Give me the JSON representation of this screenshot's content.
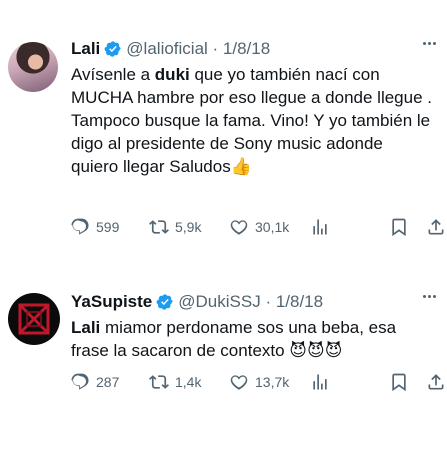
{
  "tweets": [
    {
      "name": "Lali",
      "handle": "@lalioficial",
      "date": "1/8/18",
      "text_lines": [
        [
          "Avísenle a ",
          "duki",
          " que yo también nací con"
        ],
        [
          "MUCHA hambre por eso llegue a donde llegue ."
        ],
        [
          "Tampoco busque la fama. Vino! Y yo también le"
        ],
        [
          "digo al presidente de Sony music adonde"
        ],
        [
          "quiero llegar Saludos",
          "👍"
        ]
      ],
      "stats": {
        "replies": "599",
        "reposts": "5,9k",
        "likes": "30,1k"
      }
    },
    {
      "name": "YaSupiste",
      "handle": "@DukiSSJ",
      "date": "1/8/18",
      "text_lines": [
        [
          "Lali",
          " miamor perdoname sos una beba, esa"
        ],
        [
          "frase la sacaron de contexto ",
          "😈😈😈"
        ]
      ],
      "stats": {
        "replies": "287",
        "reposts": "1,4k",
        "likes": "13,7k"
      }
    }
  ],
  "icons": {
    "verified": "verified-badge-icon",
    "reply": "reply-icon",
    "repost": "repost-icon",
    "like": "heart-icon",
    "views": "views-icon",
    "bookmark": "bookmark-icon",
    "share": "share-icon",
    "more": "more-icon"
  },
  "colors": {
    "verified": "#1d9bf0",
    "muted": "#536471",
    "text": "#0f1419"
  }
}
